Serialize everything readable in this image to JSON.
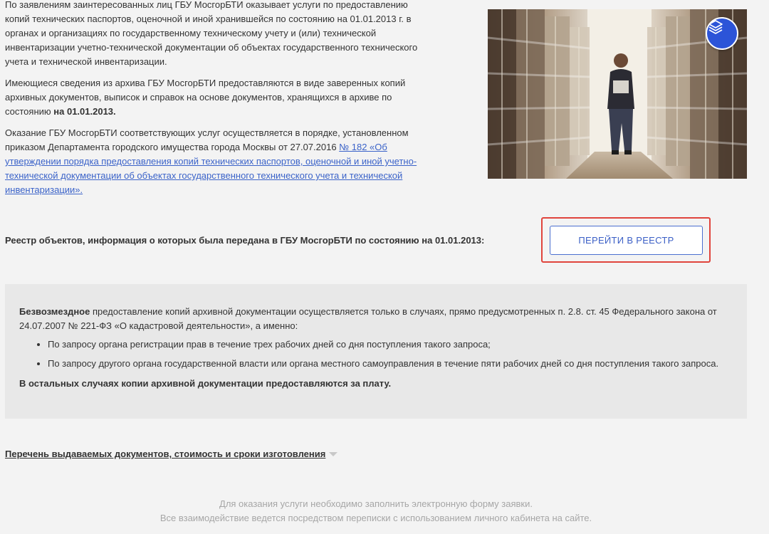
{
  "intro": {
    "p1": "По заявлениям заинтересованных лиц ГБУ МосгорБТИ оказывает услуги по предоставлению копий технических паспортов, оценочной и иной хранившейся по состоянию на 01.01.2013 г. в органах и организациях по государственному техническому учету и (или) технической инвентаризации учетно-технической документации об объектах государственного технического учета и технической инвентаризации.",
    "p2_text": "Имеющиеся сведения из архива ГБУ МосгорБТИ предоставляются в виде заверенных копий архивных документов, выписок и справок на основе документов, хранящихся в архиве по состоянию ",
    "p2_bold": "на 01.01.2013.",
    "p3_text": "Оказание ГБУ МосгорБТИ соответствующих услуг осуществляется в порядке, установленном приказом Департамента городского имущества города Москвы от 27.07.2016 ",
    "p3_link": "№ 182 «Об утверждении порядка предоставления копий технических паспортов, оценочной и иной учетно-технической документации об объектах государственного технического учета и технической инвентаризации»."
  },
  "photo": {
    "layers_icon": "layers-icon",
    "accent": "#2c54d8"
  },
  "registry": {
    "label": "Реестр объектов, информация о которых была передана в ГБУ МосгорБТИ по состоянию на 01.01.2013:",
    "button": "ПЕРЕЙТИ В РЕЕСТР",
    "highlight_color": "#e0443c"
  },
  "info": {
    "lead_bold": "Безвозмездное",
    "lead_text": " предоставление копий архивной документации осуществляется только в случаях, прямо предусмотренных п. 2.8. ст. 45 Федерального закона от 24.07.2007 № 221-ФЗ «О кадастровой деятельности», а именно:",
    "items": [
      "По запросу органа регистрации прав в течение трех рабочих дней со дня поступления такого запроса;",
      "По запросу другого органа государственной власти или органа местного самоуправления в течение пяти рабочих дней со дня поступления такого запроса."
    ],
    "closing": "В остальных случаях копии архивной документации предоставляются за плату."
  },
  "docs_link": {
    "label": "Перечень выдаваемых документов, стоимость и сроки изготовления"
  },
  "footer": {
    "line1": "Для оказания услуги необходимо заполнить электронную форму заявки.",
    "line2": "Все взаимодействие ведется посредством переписки с использованием личного кабинета на сайте."
  }
}
